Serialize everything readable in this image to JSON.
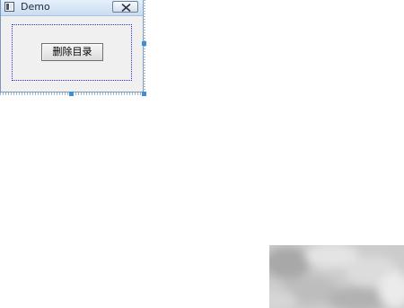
{
  "window": {
    "title": "Demo",
    "icons": {
      "app": "window-icon",
      "close": "close-icon"
    }
  },
  "content": {
    "button_label": "删除目录"
  },
  "colors": {
    "selection_handle": "#3f8fd8",
    "layout_border": "#2e2ee0",
    "dialog_background": "#f0f0f0"
  }
}
